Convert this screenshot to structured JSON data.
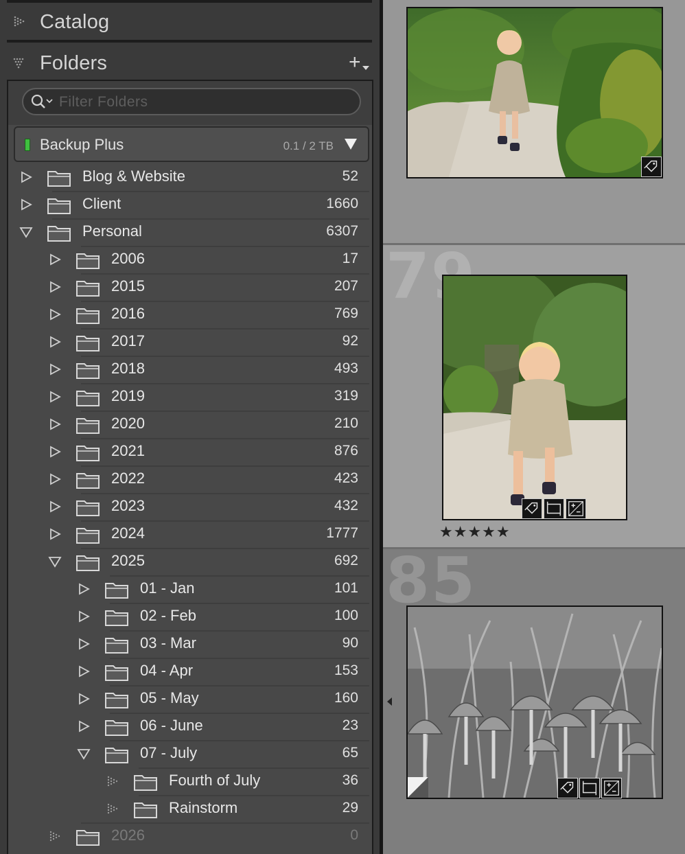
{
  "left_panel": {
    "catalog_title": "Catalog",
    "folders_title": "Folders",
    "add_button": "+",
    "filter_placeholder": "Filter Folders",
    "volume": {
      "name": "Backup Plus",
      "size": "0.1 / 2 TB",
      "status_color": "#3fbf3f"
    },
    "folders": [
      {
        "name": "Blog & Website",
        "count": "52",
        "level": 0,
        "state": "collapsed"
      },
      {
        "name": "Client",
        "count": "1660",
        "level": 0,
        "state": "collapsed"
      },
      {
        "name": "Personal",
        "count": "6307",
        "level": 0,
        "state": "expanded"
      },
      {
        "name": "2006",
        "count": "17",
        "level": 1,
        "state": "collapsed"
      },
      {
        "name": "2015",
        "count": "207",
        "level": 1,
        "state": "collapsed"
      },
      {
        "name": "2016",
        "count": "769",
        "level": 1,
        "state": "collapsed"
      },
      {
        "name": "2017",
        "count": "92",
        "level": 1,
        "state": "collapsed"
      },
      {
        "name": "2018",
        "count": "493",
        "level": 1,
        "state": "collapsed"
      },
      {
        "name": "2019",
        "count": "319",
        "level": 1,
        "state": "collapsed"
      },
      {
        "name": "2020",
        "count": "210",
        "level": 1,
        "state": "collapsed"
      },
      {
        "name": "2021",
        "count": "876",
        "level": 1,
        "state": "collapsed"
      },
      {
        "name": "2022",
        "count": "423",
        "level": 1,
        "state": "collapsed"
      },
      {
        "name": "2023",
        "count": "432",
        "level": 1,
        "state": "collapsed"
      },
      {
        "name": "2024",
        "count": "1777",
        "level": 1,
        "state": "collapsed"
      },
      {
        "name": "2025",
        "count": "692",
        "level": 1,
        "state": "expanded"
      },
      {
        "name": "01 - Jan",
        "count": "101",
        "level": 2,
        "state": "collapsed"
      },
      {
        "name": "02 - Feb",
        "count": "100",
        "level": 2,
        "state": "collapsed"
      },
      {
        "name": "03 - Mar",
        "count": "90",
        "level": 2,
        "state": "collapsed"
      },
      {
        "name": "04 - Apr",
        "count": "153",
        "level": 2,
        "state": "collapsed"
      },
      {
        "name": "05 - May",
        "count": "160",
        "level": 2,
        "state": "collapsed"
      },
      {
        "name": "06 - June",
        "count": "23",
        "level": 2,
        "state": "collapsed"
      },
      {
        "name": "07 - July",
        "count": "65",
        "level": 2,
        "state": "expanded"
      },
      {
        "name": "Fourth of July",
        "count": "36",
        "level": 3,
        "state": "leaf"
      },
      {
        "name": "Rainstorm",
        "count": "29",
        "level": 3,
        "state": "leaf"
      },
      {
        "name": "2026",
        "count": "0",
        "level": 1,
        "state": "leaf",
        "dim": true
      }
    ]
  },
  "grid": {
    "cells": [
      {
        "index": "",
        "rating": "",
        "badges": [
          "keyword-badge-icon"
        ]
      },
      {
        "index": "79",
        "rating": "★★★★★",
        "badges": [
          "keyword-badge-icon",
          "crop-badge-icon",
          "develop-badge-icon"
        ]
      },
      {
        "index": "85",
        "rating": "",
        "badges": [
          "keyword-badge-icon",
          "crop-badge-icon",
          "develop-badge-icon"
        ]
      }
    ]
  }
}
